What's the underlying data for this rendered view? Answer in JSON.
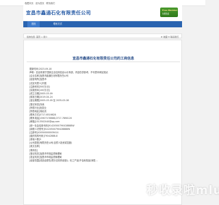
{
  "topbar": {
    "links": [
      "收藏本页",
      "设为首页",
      "联系我们"
    ]
  },
  "header": {
    "logo_text": "宜昌市鑫通石化有限责任公司",
    "badge_line1": "Free Member",
    "badge_line2": "免费会员"
  },
  "nav": {
    "items": [
      {
        "label": "首页"
      },
      {
        "label": "联系方式"
      }
    ]
  },
  "crumb": {
    "left": "您的位置: 首页 > 简介",
    "right": "★ 收藏 ✉ 联系我们"
  },
  "content": {
    "title": "宜昌市鑫通石化有限责任公司的工商信息",
    "lines": [
      "更新时间:2023-09-18",
      "声明：信息来源于国家企业信用信息公示系统，内容仅供参考，不代表本网站观点",
      "[企业名称]宜昌市鑫通石化有限责任公司",
      "[经营场所]宜昌市",
      "[法定代表人]刘强",
      "[注册资本]500万(元)",
      "[实缴资本]100万(元)",
      "[成立日期]2005-03-09",
      "[核准日期]2019-04-24",
      "[营业期限]2005-03-09 至 2035-03-08",
      "[登记状态]存续",
      "[所属行业]批发业",
      "[所属地区]湖北省",
      "[联系方式]0717-6516628",
      "[联系电话]15907178866,0717-7890120",
      "[邮箱]1513502040@qq.com",
      "[统一社会信用代码]91420500790428888W",
      "[纳税人识别号]91420500790428888W",
      "[注册号]420500000009414",
      "[组织机构代码]79042888-8",
      "[参保人数]5",
      "[公司类型]有限责任公司(自然人投资或控股)",
      "[英文名称]",
      "[曾用名]",
      "[登记机关]宜昌市市场监督管理局",
      "[发证机关]宜昌市市场监督管理局",
      "[经营范围]成品油零售(限分支机构经营)；化工产品(不含危险品)销售..."
    ]
  },
  "watermark": "秒收录啦mlu"
}
